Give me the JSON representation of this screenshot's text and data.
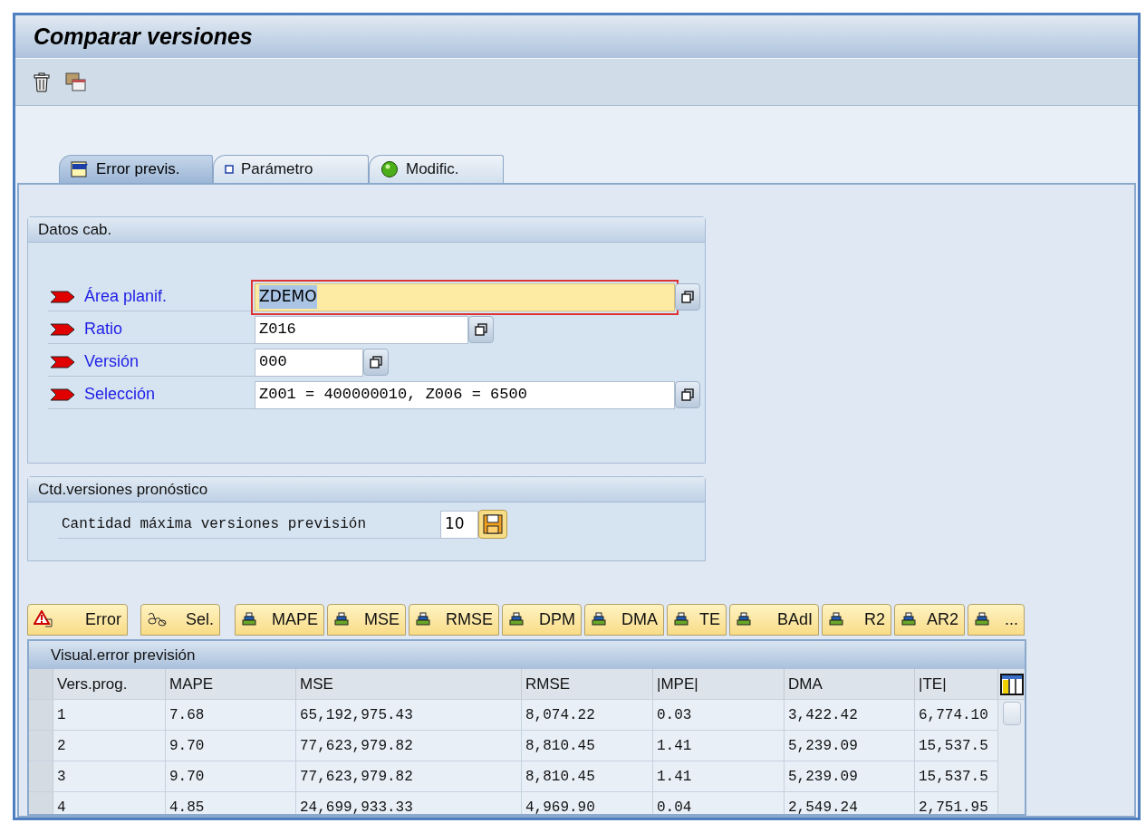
{
  "window": {
    "title": "Comparar versiones"
  },
  "tabs": [
    {
      "label": "Error previs.",
      "kind": "chart",
      "selected": true
    },
    {
      "label": "Parámetro",
      "kind": "square",
      "selected": false
    },
    {
      "label": "Modific.",
      "kind": "ball",
      "selected": false
    }
  ],
  "header_group": {
    "title": "Datos cab.",
    "fields": [
      {
        "label": "Área planif.",
        "value": "ZDEMO",
        "focused": true
      },
      {
        "label": "Ratio",
        "value": "Z016",
        "focused": false
      },
      {
        "label": "Versión",
        "value": "000",
        "focused": false
      },
      {
        "label": "Selección",
        "value": "Z001 = 400000010, Z006 = 6500",
        "focused": false
      }
    ]
  },
  "versions_group": {
    "title": "Ctd.versiones pronóstico",
    "label": "Cantidad máxima versiones previsión",
    "value": "10"
  },
  "buttons": [
    {
      "label": "Error",
      "kind": "alert"
    },
    {
      "label": "Sel.",
      "kind": "glasses"
    },
    {
      "label": "MAPE",
      "kind": "chart"
    },
    {
      "label": "MSE",
      "kind": "chart"
    },
    {
      "label": "RMSE",
      "kind": "chart"
    },
    {
      "label": "DPM",
      "kind": "chart"
    },
    {
      "label": "DMA",
      "kind": "chart"
    },
    {
      "label": "TE",
      "kind": "chart"
    },
    {
      "label": "BAdI",
      "kind": "chart"
    },
    {
      "label": "R2",
      "kind": "chart"
    },
    {
      "label": "AR2",
      "kind": "chart"
    },
    {
      "label": "...",
      "kind": "chart"
    }
  ],
  "table": {
    "title": "Visual.error previsión",
    "columns": [
      "Vers.prog.",
      "MAPE",
      "MSE",
      "RMSE",
      "|MPE|",
      "DMA",
      "|TE|"
    ],
    "rows": [
      [
        "1",
        "7.68",
        "65,192,975.43",
        "8,074.22",
        "0.03",
        "3,422.42",
        "6,774.10"
      ],
      [
        "2",
        "9.70",
        "77,623,979.82",
        "8,810.45",
        "1.41",
        "5,239.09",
        "15,537.5"
      ],
      [
        "3",
        "9.70",
        "77,623,979.82",
        "8,810.45",
        "1.41",
        "5,239.09",
        "15,537.5"
      ],
      [
        "4",
        "4.85",
        "24,699,933.33",
        "4,969.90",
        "0.04",
        "2,549.24",
        "2,751.95"
      ]
    ]
  }
}
